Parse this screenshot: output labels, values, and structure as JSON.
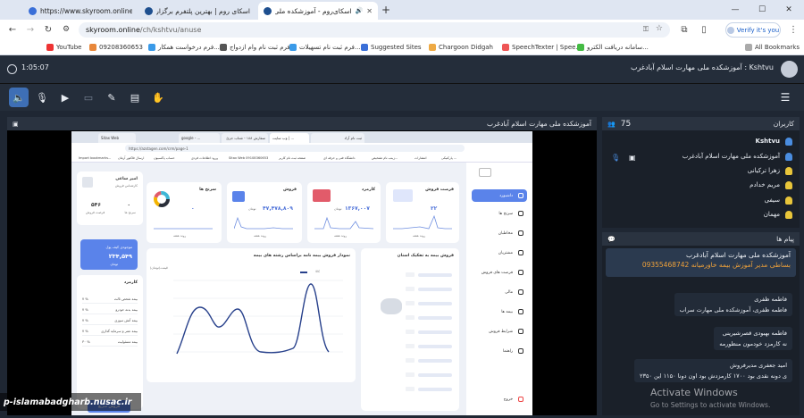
{
  "browser": {
    "tabs": [
      {
        "label": "https://www.skyroom.online/ch/kshtvu/anuse",
        "icon": "cube-icon"
      },
      {
        "label": "اسکای روم | بهترین پلتفرم برگزاری...",
        "icon": "globe-icon"
      },
      {
        "label": "اسکای‌روم - آموزشکده ملی ...",
        "icon": "globe-icon",
        "active": true
      }
    ],
    "new_tab": "+",
    "url_host": "skyroom.online",
    "url_path": "/ch/kshtvu/anuse",
    "verify_label": "Verify it's you",
    "bookmarks": [
      "YouTube",
      "09208360653",
      "فرم درخواست همکار...",
      "فرم ثبت نام وام ازدواج",
      "فرم ثبت نام تسهیلات...",
      "Suggested Sites",
      "Chargoon Didgah",
      "SpeechTexter | Spee...",
      "سامانه دریافت الکترو..."
    ],
    "all_bookmarks": "All Bookmarks"
  },
  "app": {
    "title": "Kshtvu : آموزشکده ملی مهارت اسلام آبادغرب",
    "timer": "1:05:07",
    "stage_title": "آموزشکده ملی مهارت اسلام آبادغرب"
  },
  "shared_screen": {
    "tabs": [
      "Sitax Web",
      "google - ...",
      "سفارش ۱۸۸ - شتاب جزئ",
      "وب سایت | ...",
      "ثبت نام آزاد"
    ],
    "url": "https://azstagen.com/crm/page-1",
    "bookmarks": [
      "Import bookmarks...",
      "ارسال فاکتور آرمان",
      "حساب پاکسیون",
      "ورود اطلاعات فردی",
      "Sitax Web 09108360653",
      "صفحه ثبت نام کاربر",
      "دانشگاه فنی و حرفه ای",
      "زینب نام تشخیص...",
      "انتشارات",
      "پارکنیکی ..."
    ],
    "nav": [
      "داشبورد",
      "سرنخ ها",
      "مخاطبان",
      "مشتریان",
      "فرصت های فروش",
      "مالی",
      "بیمه ها",
      "شرایط فروش",
      "راهنما",
      "خروج"
    ],
    "cards": [
      {
        "title": "فرصت فروش",
        "value": "۲۲",
        "sub": "روند هفته"
      },
      {
        "title": "کارمزد",
        "value": "۱۳۶۷,۰۰۷",
        "unit": "تومان",
        "sub": "روند هفته"
      },
      {
        "title": "فروش",
        "value": "۴۷,۴۷۸,۸۰۹",
        "unit": "تومان",
        "sub": "روند هفته"
      },
      {
        "title": "سرنخ ها",
        "value": "۰",
        "sub": "روند هفته"
      }
    ],
    "bar_chart_title": "فروش بیمه به تفکیک استان",
    "line_chart_title": "نمودار فروش بیمه نامه براساس رشته های بیمه",
    "line_legend": "کالا",
    "line_ylabel": "قیمت(تومان)",
    "profile": {
      "name": "امیر ساعی",
      "role": "کارشناس فروش",
      "stat1_label": "سرنخ ها",
      "stat1_value": "۰",
      "stat2_label": "فرصت فروش",
      "stat2_value": "۵۴۶",
      "wallet_label": "موجودی کیف پول",
      "wallet_value": "۲۳۴,۵۴۹",
      "wallet_unit": "تومان",
      "commission_title": "کارمزد",
      "rows": [
        {
          "label": "بیمه شخص ثالث",
          "value": "۷ %"
        },
        {
          "label": "بیمه بدنه خودرو",
          "value": "۷ %"
        },
        {
          "label": "بیمه آتش سوزی",
          "value": "۷ %"
        },
        {
          "label": "بیمه عمر و سرمایه گذاری",
          "value": "۷ %"
        },
        {
          "label": "بیمه مسئولیت",
          "value": "۳۰ %"
        }
      ],
      "new_sale": "فروش سریع"
    }
  },
  "users": {
    "header": "کاربران",
    "count": "75",
    "list": [
      {
        "name": "Kshtvu",
        "color": "#4a8de0"
      },
      {
        "name": "آموزشکده ملی مهارت اسلام آبادغرب",
        "color": "#4a8de0"
      },
      {
        "name": "زهرا ترکیانی",
        "color": "#e8c53a"
      },
      {
        "name": "مریم خدادم",
        "color": "#e8c53a"
      },
      {
        "name": "سیفی",
        "color": "#e8c53a"
      },
      {
        "name": "مهمان",
        "color": "#e8c53a"
      }
    ]
  },
  "chat": {
    "header": "پیام ها",
    "pinned_name": "آموزشکده ملی مهارت اسلام آبادغرب",
    "pinned_text": "09355468742 بساطی مدیر آموزش بیمه خاورمیانه",
    "messages": [
      {
        "name": "فاطمه ظفری",
        "text": "فاطمه ظفری، آموزشکده ملی مهارت سراب"
      },
      {
        "name": "فاطمه بهبودی قصرشیرینی",
        "text": "نه کارمزد خودمون منظورمه"
      },
      {
        "name": "امید جعفری مدیرفروش",
        "text": "ی دونه نقدی بود ۱۷۰۰ کارمزدش بود اون دونا ۱۱۵۰ این ۲۳۵۰"
      }
    ]
  },
  "system": {
    "activate_title": "Activate Windows",
    "activate_sub": "Go to Settings to activate Windows."
  },
  "watermark": "p-islamabadgharb.nusac.ir"
}
